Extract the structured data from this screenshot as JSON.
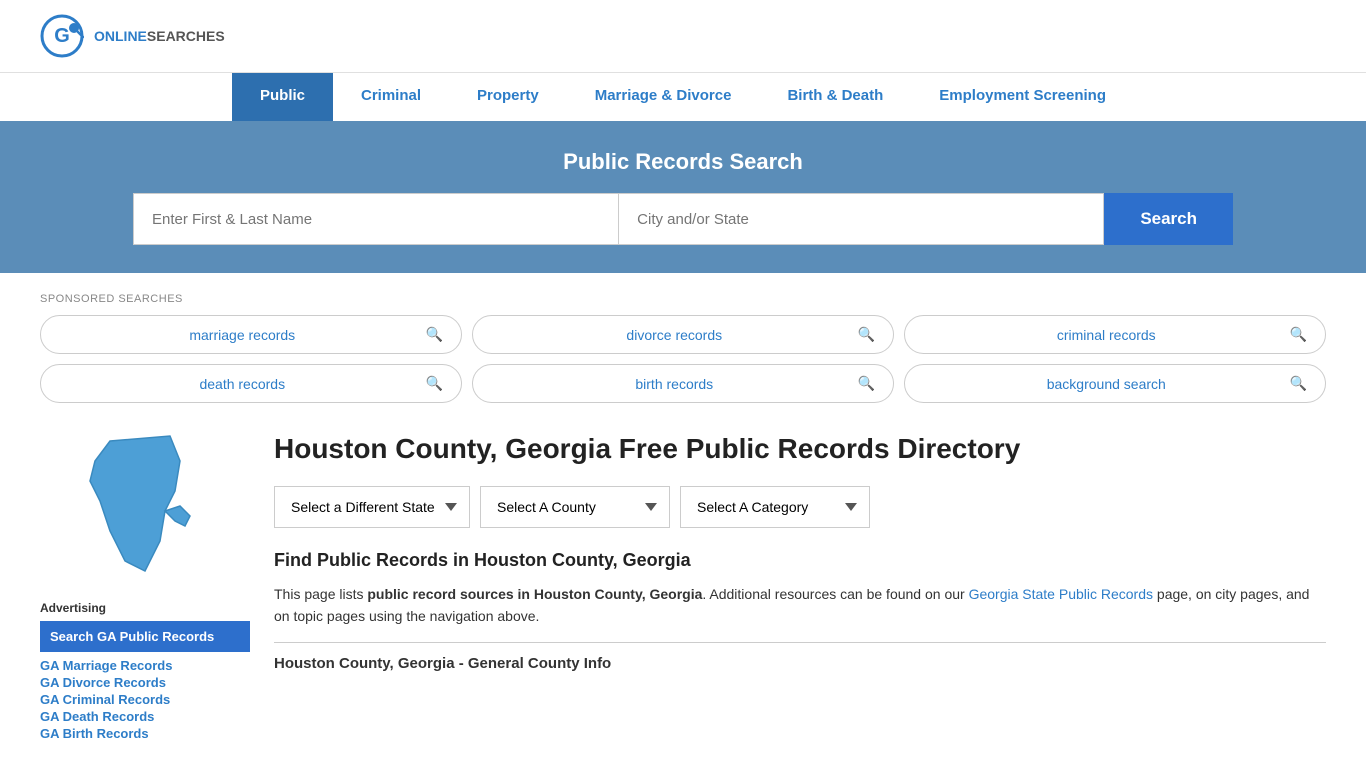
{
  "site": {
    "logo_online": "ONLINE",
    "logo_searches": "SEARCHES"
  },
  "nav": {
    "items": [
      {
        "label": "Public",
        "active": true
      },
      {
        "label": "Criminal",
        "active": false
      },
      {
        "label": "Property",
        "active": false
      },
      {
        "label": "Marriage & Divorce",
        "active": false
      },
      {
        "label": "Birth & Death",
        "active": false
      },
      {
        "label": "Employment Screening",
        "active": false
      }
    ]
  },
  "search_banner": {
    "title": "Public Records Search",
    "name_placeholder": "Enter First & Last Name",
    "location_placeholder": "City and/or State",
    "button_label": "Search"
  },
  "sponsored": {
    "label": "SPONSORED SEARCHES",
    "pills": [
      "marriage records",
      "divorce records",
      "criminal records",
      "death records",
      "birth records",
      "background search"
    ]
  },
  "page_title": "Houston County, Georgia Free Public Records Directory",
  "selectors": {
    "state_label": "Select a Different State",
    "county_label": "Select A County",
    "category_label": "Select A Category"
  },
  "find_heading": "Find Public Records in Houston County, Georgia",
  "description": "This page lists ",
  "description_bold": "public record sources in Houston County, Georgia",
  "description2": ". Additional resources can be found on our ",
  "description_link": "Georgia State Public Records",
  "description3": " page, on city pages, and on topic pages using the navigation above.",
  "general_info_heading": "Houston County, Georgia - General County Info",
  "advertising_label": "Advertising",
  "sidebar_ad": {
    "label": "Search GA Public Records"
  },
  "sidebar_links": [
    "GA Marriage Records",
    "GA Divorce Records",
    "GA Criminal Records",
    "GA Death Records",
    "GA Birth Records"
  ]
}
